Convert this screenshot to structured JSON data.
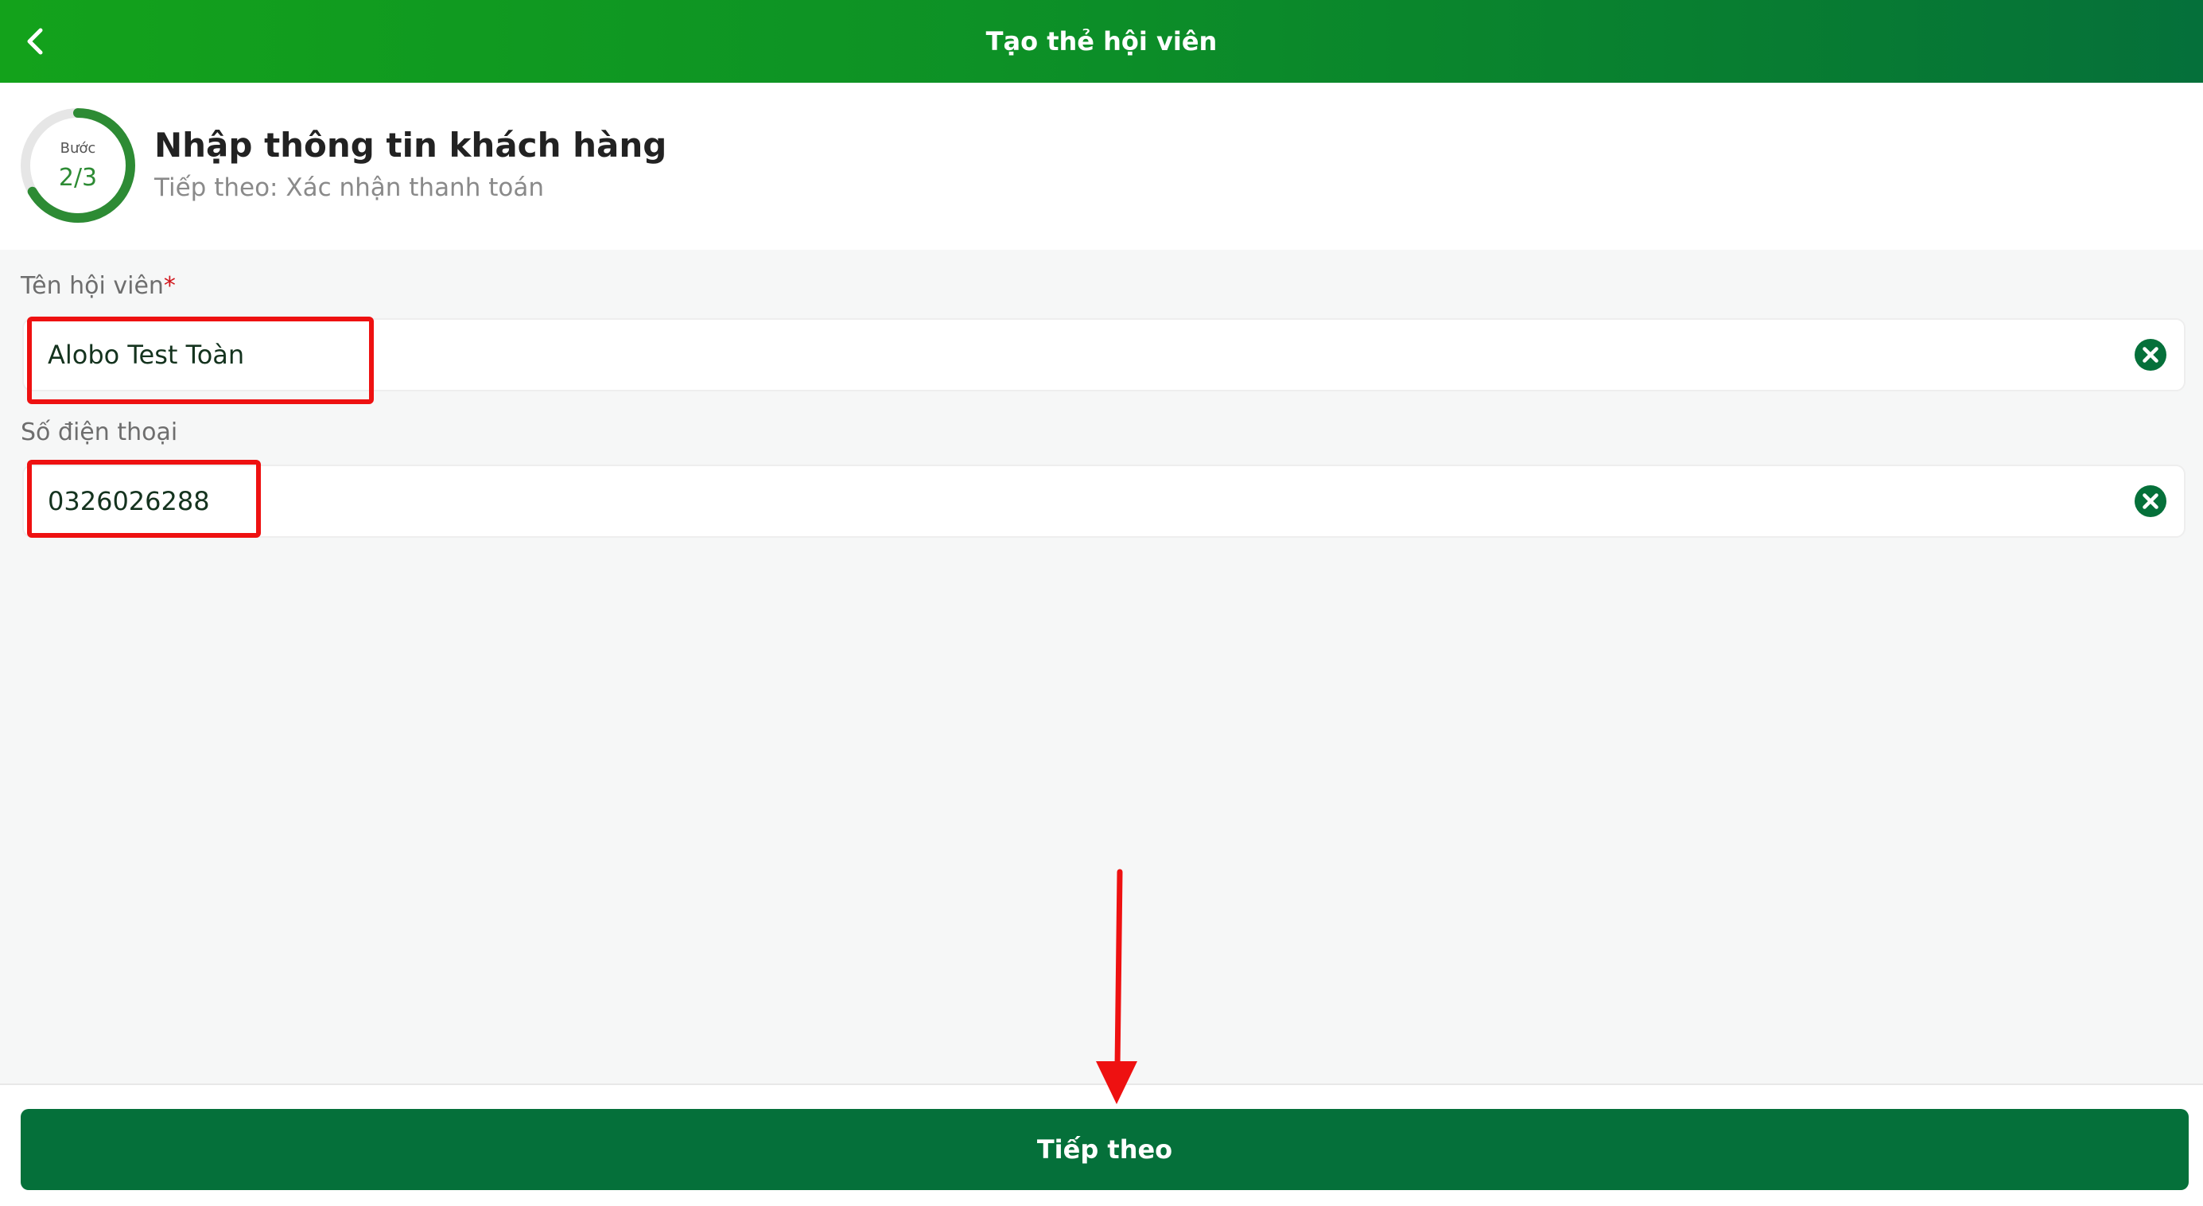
{
  "header": {
    "title": "Tạo thẻ hội viên",
    "back_icon": "chevron-left-icon"
  },
  "step": {
    "word": "Bước",
    "count": "2/3",
    "progress": 0.667,
    "title": "Nhập thông tin khách hàng",
    "subtitle": "Tiếp theo: Xác nhận thanh toán"
  },
  "form": {
    "name": {
      "label": "Tên hội viên",
      "required_mark": "*",
      "value": "Alobo Test Toàn",
      "clear_icon": "clear-circle-icon"
    },
    "phone": {
      "label": "Số điện thoại",
      "value": "0326026288",
      "clear_icon": "clear-circle-icon"
    }
  },
  "footer": {
    "next_label": "Tiếp theo"
  },
  "colors": {
    "header_start": "#13a21b",
    "header_end": "#05703a",
    "primary": "#05703a",
    "step_ring": "#2d8b34",
    "annotation": "#ee1111"
  }
}
